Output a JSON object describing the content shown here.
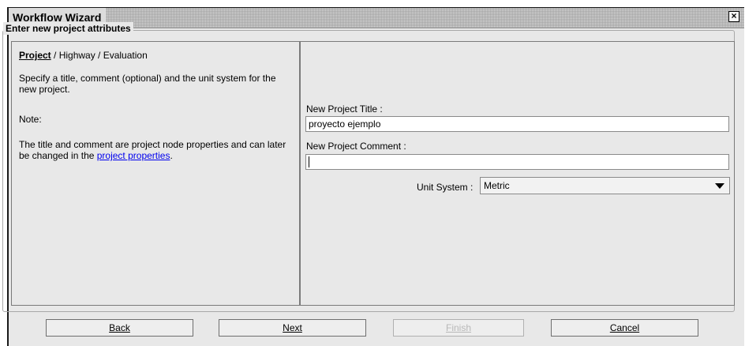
{
  "window": {
    "title": "Workflow Wizard",
    "close_glyph": "×"
  },
  "group": {
    "title": "Enter new project attributes"
  },
  "steps": {
    "current": "Project",
    "rest": " / Highway / Evaluation"
  },
  "info": {
    "description": "Specify a title, comment (optional) and the unit system for the new project.",
    "note_label": "Note:",
    "note_text": "The title and comment are project node properties and can later be changed in the ",
    "note_link": "project properties",
    "note_end": "."
  },
  "form": {
    "title_label": "New Project Title :",
    "title_value": "proyecto ejemplo",
    "comment_label": "New Project Comment :",
    "comment_value": "",
    "unit_label": "Unit System :",
    "unit_value": "Metric"
  },
  "buttons": {
    "back": "Back",
    "next": "Next",
    "finish": "Finish",
    "cancel": "Cancel"
  }
}
